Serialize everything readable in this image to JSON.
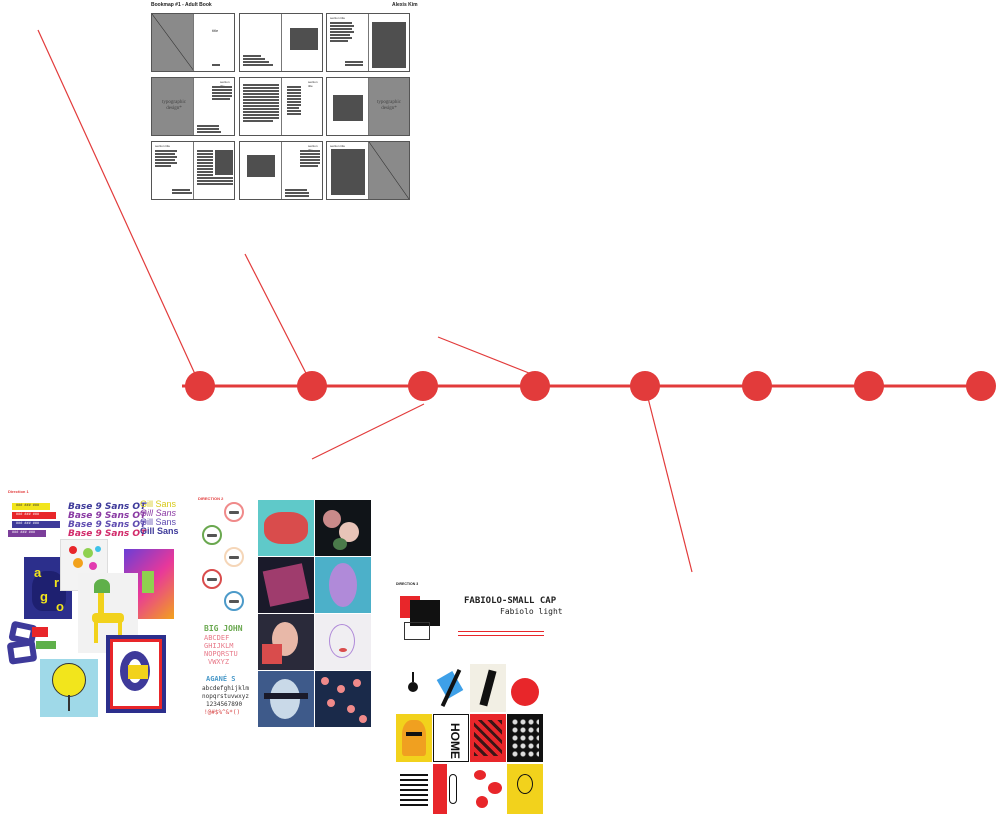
{
  "book_map": {
    "title": "Bookmap #1 - Adult Book",
    "author": "Alexis Kim",
    "typographic_text": "typographic\ndesign*",
    "section_title": "section title",
    "title_word": "title"
  },
  "direction1": {
    "label": "Direction 1",
    "swatches": [
      "###  ###  ###",
      "###  ###  ###",
      "###  ###  ###",
      "###  ###  ###"
    ],
    "base9": [
      "Base 9 Sans OT",
      "Base 9 Sans OT",
      "Base 9 Sans OT",
      "Base 9 Sans OT"
    ],
    "gill": [
      "Gill Sans",
      "Gill Sans",
      "Gill Sans",
      "Gill Sans"
    ],
    "poster_letters": [
      "a",
      "r",
      "g",
      "o"
    ]
  },
  "direction2": {
    "label": "DIRECTION 2",
    "big_john_title": "BIG JOHN",
    "big_john_lines": [
      "ABCDEF",
      "GHIJKLM",
      "NOPQRSTU",
      "VWXYZ"
    ],
    "agane_title": "AGANÉ S",
    "agane_lines": [
      "abcdefghijklm",
      "nopqrstuvwxyz",
      "1234567890",
      "!@#$%^&*()"
    ]
  },
  "direction3": {
    "label": "DIRECTION 3",
    "font_name_1": "FABIOLO-SMALL CAP",
    "font_name_2": "Fabiolo light",
    "home_text": "HOME"
  },
  "timeline": {
    "node_count": 8,
    "color": "#e23b3b"
  },
  "colors": {
    "accent": "#e23b3b",
    "gray": "#8a8a8a",
    "dark": "#4f4f4f"
  }
}
